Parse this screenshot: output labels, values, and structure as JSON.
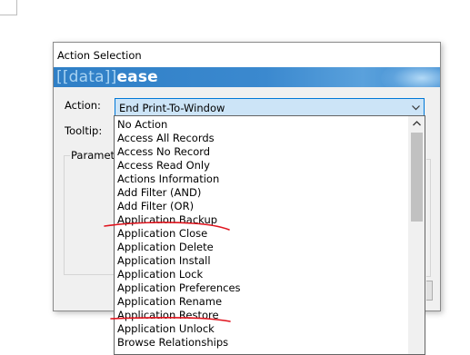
{
  "dialog": {
    "title": "Action Selection",
    "logo": {
      "left_bracket": "[",
      "mid": "[data]]",
      "brand": "ease"
    },
    "action_label": "Action:",
    "action_value": "End Print-To-Window",
    "tooltip_label": "Tooltip:",
    "parameters_label": "Paramete"
  },
  "dropdown": {
    "items": [
      "No Action",
      "Access All Records",
      "Access No Record",
      "Access Read Only",
      "Actions Information",
      "Add Filter (AND)",
      "Add Filter (OR)",
      "Application Backup",
      "Application Close",
      "Application Delete",
      "Application Install",
      "Application Lock",
      "Application Preferences",
      "Application Rename",
      "Application Restore",
      "Application Unlock",
      "Browse Relationships"
    ]
  },
  "icons": {
    "combo_arrow": "chevron-down-icon",
    "scroll_up": "chevron-up-icon"
  },
  "colors": {
    "banner": "#3b89cf",
    "combo_focus_border": "#0078d7",
    "combo_bg": "#cce4f7",
    "annotation": "#e0141e"
  }
}
